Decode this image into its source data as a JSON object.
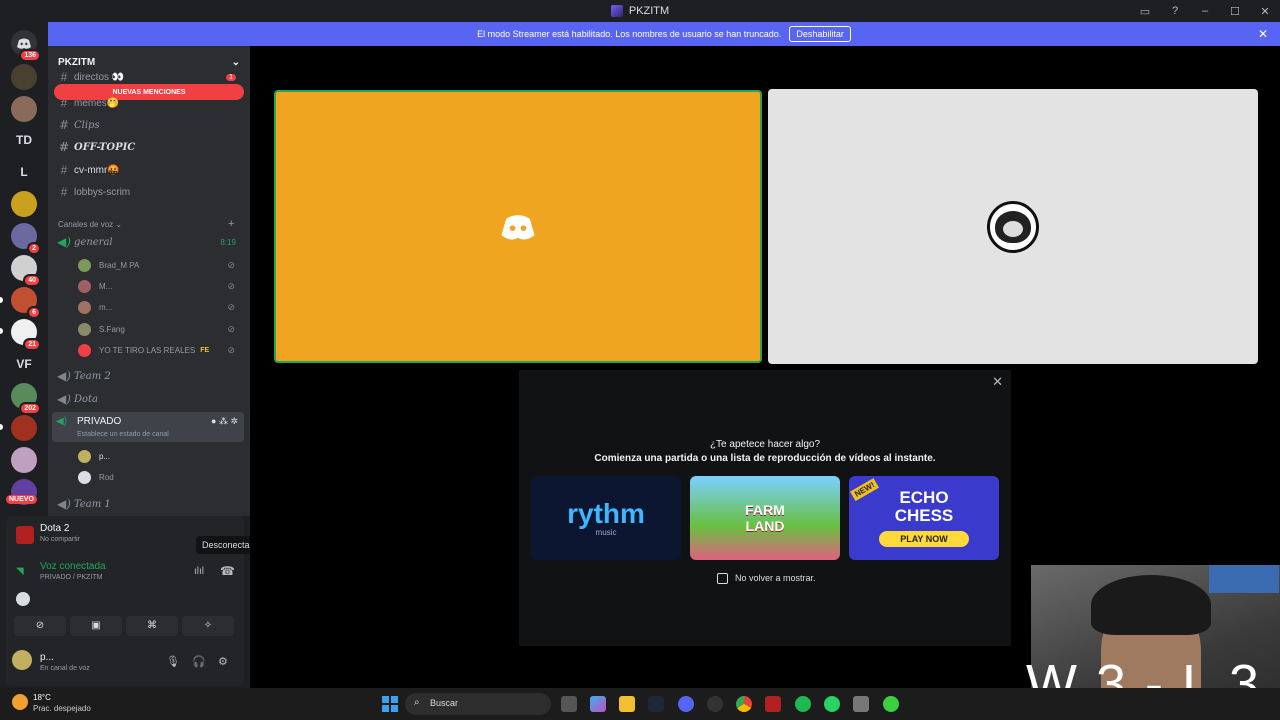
{
  "window": {
    "title": "PKZITM"
  },
  "banner": {
    "text": "El modo Streamer está habilitado. Los nombres de usuario se han truncado.",
    "button": "Deshabilitar"
  },
  "guilds": {
    "top_badge": "136",
    "items": [
      {
        "label": "",
        "badge": ""
      },
      {
        "label": "",
        "badge": ""
      },
      {
        "label": "TD",
        "badge": ""
      },
      {
        "label": "L",
        "badge": ""
      },
      {
        "label": "",
        "badge": ""
      },
      {
        "label": "",
        "badge": "2"
      },
      {
        "label": "",
        "badge": "40"
      },
      {
        "label": "",
        "badge": "6"
      },
      {
        "label": "",
        "badge": "21"
      },
      {
        "label": "VF",
        "badge": ""
      },
      {
        "label": "",
        "badge": "202"
      },
      {
        "label": "",
        "badge": ""
      },
      {
        "label": "",
        "badge": ""
      }
    ],
    "new_label": "NUEVO"
  },
  "sidebar": {
    "server_name": "PKZITM",
    "mentions_banner": "NUEVAS MENCIONES",
    "channels": [
      {
        "name": "directos 👀",
        "badge": "1"
      },
      {
        "name": "memes🤭"
      },
      {
        "name": "Clips"
      },
      {
        "name": "OFF-TOPIC"
      },
      {
        "name": "cv-mmr🤬"
      },
      {
        "name": "lobbys-scrim"
      }
    ],
    "voice_section": "Canales de voz",
    "voice_general": {
      "name": "general",
      "time": "8:19"
    },
    "general_members": [
      "Brad_M PA",
      "M...",
      "m...",
      "S.Fang",
      "YO TE TIRO LAS REALES"
    ],
    "member_tag": "FE",
    "voice_channels": [
      "Team 2",
      "Dota"
    ],
    "privado": {
      "name": "PRIVADO",
      "status": "Establece un estado de canal",
      "members": [
        "p...",
        "Rod"
      ]
    },
    "team1": "Team 1"
  },
  "panel": {
    "activity": {
      "name": "Dota 2",
      "sub": "No compartir"
    },
    "tooltip": "Desconectar",
    "voice": {
      "status": "Voz conectada",
      "channel": "PRIVADO / PKZITM"
    },
    "user": {
      "name": "p...",
      "status": "En canal de voz"
    }
  },
  "modal": {
    "heading": "¿Te apetece hacer algo?",
    "subheading": "Comienza una partida o una lista de reproducción de vídeos al instante.",
    "cards": [
      {
        "title": "rythm",
        "sub": "music"
      },
      {
        "title": "FARM LAND",
        "sub": ""
      },
      {
        "title": "ECHO CHESS",
        "sub": "PLAY NOW",
        "tag": "NEW!"
      }
    ],
    "checkbox": "No volver a mostrar."
  },
  "overlay": {
    "score": "W 3 - L 3"
  },
  "taskbar": {
    "weather_temp": "18°C",
    "weather_desc": "Prac. despejado",
    "search": "Buscar"
  },
  "colors": {
    "blurple": "#5865f2",
    "orange_tile": "#f0a520",
    "green": "#23a55a",
    "red": "#f23f43"
  }
}
